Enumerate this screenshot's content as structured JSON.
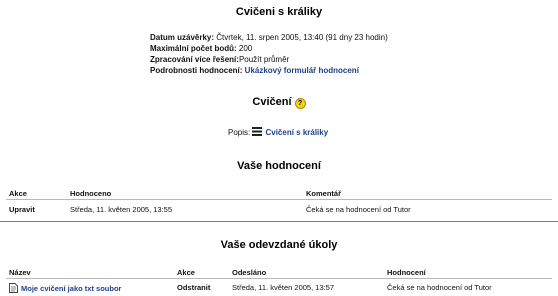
{
  "assignment": {
    "title": "Cvičeni s králiky",
    "info": [
      {
        "label": "Datum uzávěrky:",
        "value": " Čtvrtek, 11. srpen 2005, 13:40 (91 dny 23 hodin)"
      },
      {
        "label": "Maximální počet bodů:",
        "value": " 200"
      },
      {
        "label": "Zpracování více řešení:",
        "value": "Použít průměr"
      },
      {
        "label": "Podrobnosti hodnocení:",
        "value": "Ukázkový formulář hodnocení"
      }
    ]
  },
  "exercise": {
    "title": "Cvičení",
    "help_icon": "question-mark-icon",
    "desc_label": "Popis:",
    "desc_link": "Cvičení s králiky",
    "desc_icon": "list-icon"
  },
  "grades": {
    "title": "Vaše hodnocení",
    "headers": {
      "action": "Akce",
      "grade": "Hodnoceno",
      "comment": "Komentář"
    },
    "row": {
      "action": "Upravit",
      "grade": "Středa, 11. květen 2005, 13:55",
      "comment": "Čeká se na hodnocení od Tutor"
    }
  },
  "submissions": {
    "title": "Vaše odevzdané úkoly",
    "headers": {
      "name": "Název",
      "action": "Akce",
      "sent": "Odesláno",
      "grade": "Hodnocení"
    },
    "row": {
      "name": "Moje cvičení jako txt soubor",
      "file_icon": "text-file-icon",
      "action": "Odstranit",
      "sent": "Středa, 11. květen 2005, 13:57",
      "grade": "Čeká se na hodnocení od Tutor"
    }
  },
  "colors": {
    "link": "#1f3f8a",
    "divider": "#7f7f7f"
  }
}
